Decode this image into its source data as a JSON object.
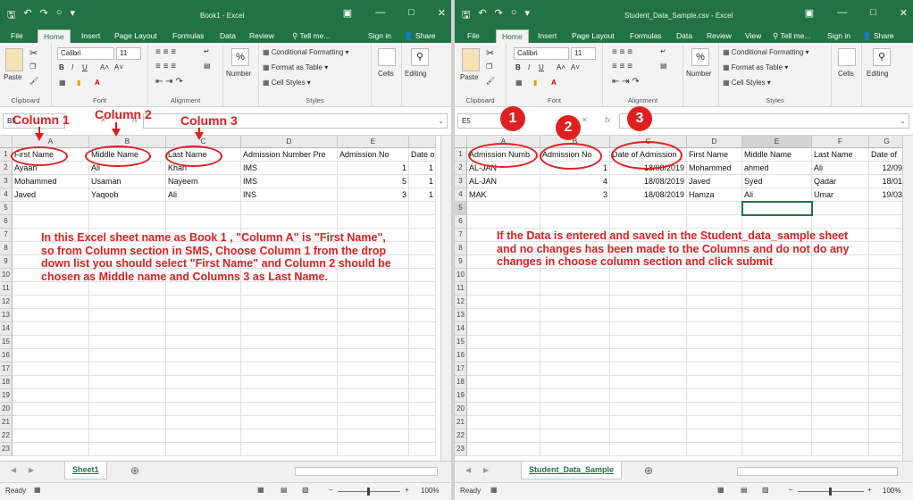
{
  "left": {
    "window_title": "Book1 - Excel",
    "tabs": [
      "File",
      "Home",
      "Insert",
      "Page Layout",
      "Formulas",
      "Data",
      "Review",
      "Tell me...",
      "Sign in",
      "Share"
    ],
    "ribbon": {
      "paste": "Paste",
      "clipboard": "Clipboard",
      "font_name": "Calibri",
      "font_size": "11",
      "font_group": "Font",
      "alignment": "Alignment",
      "number": "Number",
      "conditional_formatting": "Conditional Formatting",
      "format_as_table": "Format as Table",
      "cell_styles": "Cell Styles",
      "styles": "Styles",
      "cells": "Cells",
      "editing": "Editing"
    },
    "name_box": "B5",
    "columns": [
      "A",
      "B",
      "C",
      "D",
      "E"
    ],
    "column_e_partial": "",
    "rows": [
      "1",
      "2",
      "3",
      "4",
      "5",
      "6",
      "7",
      "8",
      "9",
      "10",
      "11",
      "12",
      "13",
      "14",
      "15",
      "16",
      "17",
      "18",
      "19",
      "20",
      "21",
      "22",
      "23"
    ],
    "headers": [
      "First Name",
      "Middle Name",
      "Last Name",
      "Admission Number Pre",
      "Admission No",
      "Date of"
    ],
    "data": [
      [
        "Ayaan",
        "Ali",
        "Khan",
        "IMS",
        "1",
        "1"
      ],
      [
        "Mohammed",
        "Usaman",
        "Nayeem",
        "IMS",
        "5",
        "1"
      ],
      [
        "Javed",
        "Yaqoob",
        "Ali",
        "INS",
        "3",
        "1"
      ]
    ],
    "sheet_tab": "Sheet1",
    "status": "Ready",
    "zoom": "100%"
  },
  "right": {
    "window_title": "Student_Data_Sample.csv - Excel",
    "tabs": [
      "File",
      "Home",
      "Insert",
      "Page Layout",
      "Formulas",
      "Data",
      "Review",
      "View",
      "Tell me...",
      "Sign in",
      "Share"
    ],
    "name_box": "E5",
    "columns": [
      "A",
      "B",
      "C",
      "D",
      "E",
      "F",
      "G"
    ],
    "headers": [
      "Admission Numb",
      "Admission No",
      "Date of Admission",
      "First Name",
      "Middle Name",
      "Last Name",
      "Date of"
    ],
    "data": [
      [
        "AL-JAN",
        "1",
        "18/08/2019",
        "Mohammed",
        "ahmed",
        "Ali",
        "12/09"
      ],
      [
        "AL-JAN",
        "4",
        "18/08/2019",
        "Javed",
        "Syed",
        "Qadar",
        "18/01"
      ],
      [
        "MAK",
        "3",
        "18/08/2019",
        "Hamza",
        "Ali",
        "Umar",
        "19/03"
      ]
    ],
    "sheet_tab": "Student_Data_Sample",
    "status": "Ready",
    "zoom": "100%"
  },
  "annotations": {
    "col1": "Column 1",
    "col2": "Column 2",
    "col3": "Column 3",
    "left_note": "In this Excel sheet name as Book 1 , \"Column A\" is \"First Name\", so from Column section in SMS, Choose Column 1 from the drop down list you should select \"First Name\" and Column 2 should be chosen as Middle name and Columns 3 as Last Name.",
    "right_note": "If the Data is entered and saved in the Student_data_sample sheet and no changes has been made to the Columns and do not do any changes in choose column section and click submit",
    "badge1": "1",
    "badge2": "2",
    "badge3": "3"
  },
  "colors": {
    "excel_green": "#217346",
    "annotation_red": "#e02020"
  }
}
